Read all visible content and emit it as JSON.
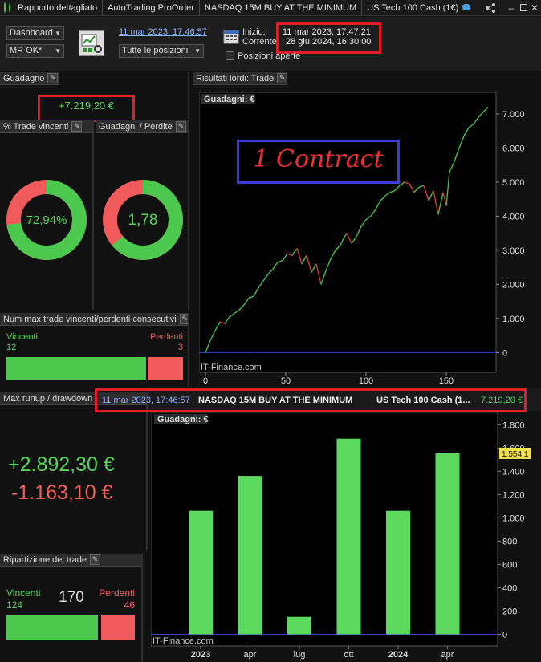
{
  "titlebar": {
    "tabs": [
      "Rapporto dettagliato",
      "AutoTrading ProOrder",
      "NASDAQ 15M BUY AT THE MINIMUM",
      "US Tech 100 Cash (1€)"
    ]
  },
  "toolbar": {
    "view_select": "Dashboard",
    "status_select": "MR OK*",
    "date_link": "11 mar 2023, 17:46:57",
    "positions_select": "Tutte le posizioni",
    "start_label": "Inizio:",
    "start_value": "11 mar 2023, 17:47:21",
    "current_label": "Corrente:",
    "current_value": "28 giu 2024, 16:30:00",
    "open_positions_label": "Posizioni aperte"
  },
  "gain": {
    "title": "Guadagno",
    "value": "+7.219,20 €"
  },
  "win_pct": {
    "title": "% Trade vincenti",
    "value": "72,94%",
    "fraction": 0.7294
  },
  "gain_loss": {
    "title": "Guadagni / Perdite",
    "value": "1,78",
    "fraction": 0.64
  },
  "consecutive": {
    "title": "Num max trade vincenti/perdenti consecutivi",
    "win_label": "Vincenti",
    "win_value": "12",
    "loss_label": "Perdenti",
    "loss_value": "3"
  },
  "runup": {
    "title": "Max runup / drawdown",
    "runup": "+2.892,30 €",
    "drawdown": "-1.163,10 €"
  },
  "distribution": {
    "title": "Ripartizione dei trade",
    "win_label": "Vincenti",
    "win_value": "124",
    "total": "170",
    "loss_label": "Perdenti",
    "loss_value": "46"
  },
  "results_panel": {
    "title": "Risultati lordi: Trade"
  },
  "strip": {
    "date": "11 mar 2023, 17:46:57",
    "strategy": "NASDAQ 15M BUY AT THE MINIMUM",
    "instrument": "US Tech 100 Cash (1...",
    "value": "7.219,20 €"
  },
  "annotation": "1 Contract",
  "watermark": "IT-Finance.com",
  "colors": {
    "green": "#57d45a",
    "red": "#f25d5d",
    "annotation_blue": "#3a3adf",
    "highlight_red": "#e11d2a"
  },
  "chart_data": [
    {
      "type": "line",
      "title": "Guadagni: €",
      "x_ticks": [
        "0",
        "50",
        "100",
        "150"
      ],
      "y_ticks": [
        "0",
        "1.000",
        "2.000",
        "3.000",
        "4.000",
        "5.000",
        "6.000",
        "7.000"
      ],
      "xlim": [
        0,
        178
      ],
      "ylim": [
        -250,
        7350
      ],
      "x": [
        0,
        3,
        6,
        9,
        12,
        15,
        18,
        21,
        24,
        27,
        30,
        33,
        36,
        39,
        42,
        45,
        48,
        51,
        54,
        57,
        60,
        63,
        66,
        69,
        72,
        75,
        78,
        81,
        84,
        86,
        88,
        91,
        94,
        97,
        100,
        103,
        106,
        109,
        112,
        115,
        118,
        121,
        124,
        127,
        130,
        133,
        136,
        139,
        142,
        145,
        148,
        150,
        152,
        155,
        158,
        161,
        164,
        167,
        170,
        173,
        176
      ],
      "y": [
        0,
        350,
        650,
        900,
        850,
        1050,
        1150,
        1250,
        1400,
        1600,
        1650,
        1900,
        2100,
        2300,
        2450,
        2650,
        2700,
        2900,
        2850,
        3050,
        2600,
        2850,
        2350,
        2600,
        2000,
        2400,
        2750,
        3000,
        3150,
        3350,
        3500,
        3200,
        3400,
        3700,
        3900,
        4000,
        4200,
        4450,
        4600,
        4700,
        4750,
        4900,
        5000,
        4950,
        4700,
        4850,
        4900,
        4450,
        4750,
        4050,
        4700,
        4300,
        5300,
        5600,
        6000,
        6350,
        6600,
        6700,
        6900,
        7050,
        7200
      ],
      "series_colors": {
        "up": "#4cc84f",
        "down": "#e33b3b"
      }
    },
    {
      "type": "bar",
      "title": "Guadagni: €",
      "categories": [
        "2023-Q1",
        "2023-Q2",
        "2023-Q3",
        "2023-Q4",
        "2024-Q1",
        "2024-Q2"
      ],
      "values": [
        1060,
        1360,
        150,
        1680,
        1060,
        1554.1
      ],
      "x_tick_labels": [
        "2023",
        "apr",
        "lug",
        "ott",
        "2024",
        "apr"
      ],
      "y_ticks": [
        "0",
        "200",
        "400",
        "600",
        "800",
        "1.000",
        "1.200",
        "1.400",
        "1.600",
        "1.800"
      ],
      "ylim": [
        -100,
        1850
      ],
      "last_value_label": "1.554,1",
      "bar_color": "#5dd95f"
    }
  ]
}
